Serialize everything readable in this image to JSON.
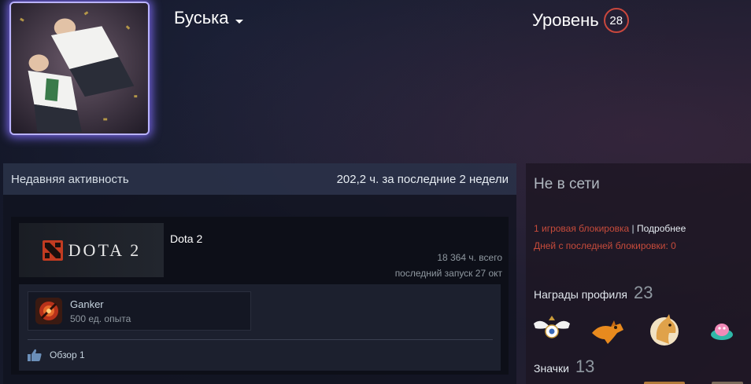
{
  "profile": {
    "persona_name": "Буська",
    "level_label": "Уровень",
    "level_value": "28"
  },
  "activity": {
    "title": "Недавняя активность",
    "hours_summary": "202,2 ч. за последние 2 недели",
    "game": {
      "logo_text": "DOTA 2",
      "name": "Dota 2",
      "total_hours": "18 364 ч. всего",
      "last_played": "последний запуск 27 окт",
      "achievement": {
        "name": "Ganker",
        "xp": "500 ед. опыта"
      },
      "review_label": "Обзор 1"
    }
  },
  "sidebar": {
    "status": "Не в сети",
    "ban_count": "1 игровая блокировка",
    "ban_separator": "|",
    "ban_details_link": "Подробнее",
    "days_since_ban": "Дней с последней блокировки: 0",
    "rewards_label": "Награды профиля",
    "rewards_count": "23",
    "badges_label": "Значки",
    "badges_count": "13"
  },
  "colors": {
    "level_ring": "#c9473d",
    "ban_text": "#c74b3b",
    "avatar_glow": "#8c7cff"
  }
}
